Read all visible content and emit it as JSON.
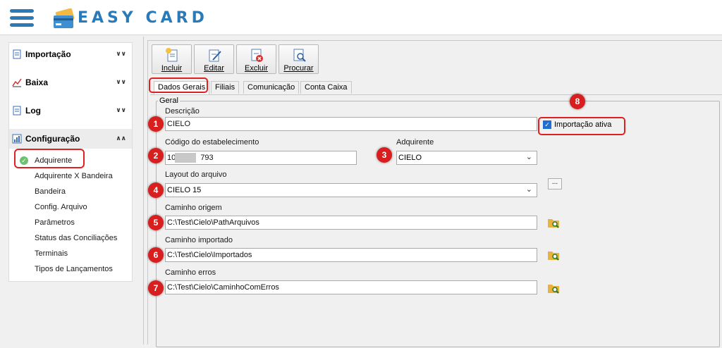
{
  "app": {
    "title": "EASY CARD"
  },
  "sidebar": {
    "sections": [
      {
        "label": "Importação",
        "icon": "document-icon",
        "expanded": false
      },
      {
        "label": "Baixa",
        "icon": "chart-icon",
        "expanded": false
      },
      {
        "label": "Log",
        "icon": "document-icon",
        "expanded": false
      },
      {
        "label": "Configuração",
        "icon": "settings-chart-icon",
        "expanded": true
      }
    ],
    "items": [
      "Adquirente",
      "Adquirente X Bandeira",
      "Bandeira",
      "Config. Arquivo",
      "Parâmetros",
      "Status das Conciliações",
      "Terminais",
      "Tipos de Lançamentos"
    ],
    "selected": "Adquirente"
  },
  "toolbar": {
    "incluir": "Incluir",
    "editar": "Editar",
    "excluir": "Excluir",
    "procurar": "Procurar"
  },
  "tabs": [
    "Dados Gerais",
    "Filiais",
    "Comunicação",
    "Conta Caixa"
  ],
  "form": {
    "group_title": "Geral",
    "descricao_label": "Descrição",
    "descricao_value": "CIELO",
    "importacao_ativa_label": "Importação ativa",
    "importacao_ativa_checked": true,
    "codigo_label": "Código do estabelecimento",
    "codigo_prefix": "10",
    "codigo_suffix": "793",
    "adquirente_label": "Adquirente",
    "adquirente_value": "CIELO",
    "layout_label": "Layout do arquivo",
    "layout_value": "CIELO 15",
    "dots_label": "...",
    "origem_label": "Caminho origem",
    "origem_value": "C:\\Test\\Cielo\\PathArquivos",
    "importado_label": "Caminho importado",
    "importado_value": "C:\\Test\\Cielo\\Importados",
    "erros_label": "Caminho erros",
    "erros_value": "C:\\Test\\Cielo\\CaminhoComErros"
  },
  "badges": [
    "1",
    "2",
    "3",
    "4",
    "5",
    "6",
    "7",
    "8"
  ],
  "colors": {
    "brand": "#2a7ab8",
    "highlight": "#e02020",
    "badge": "#d81e1e"
  }
}
